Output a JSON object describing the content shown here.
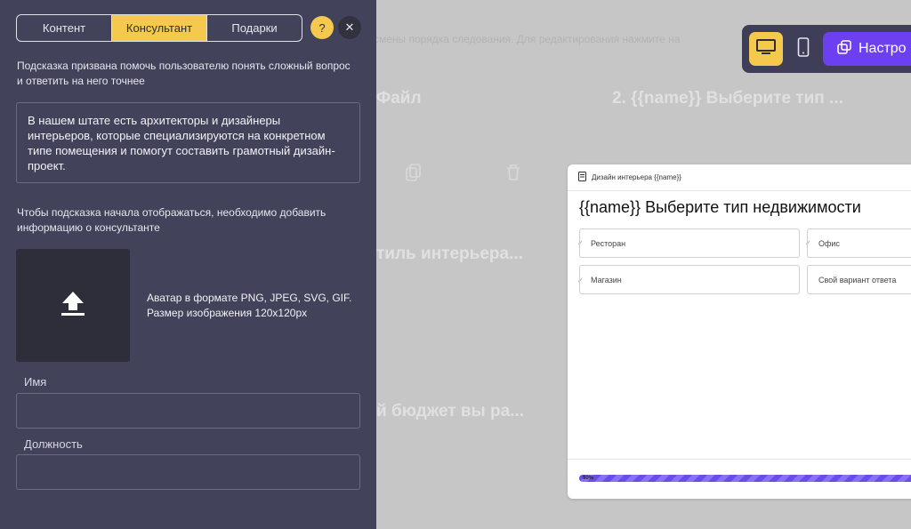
{
  "panel": {
    "tabs": [
      "Контент",
      "Консультант",
      "Подарки"
    ],
    "active_tab": 1,
    "help_label": "?",
    "close_label": "✕",
    "intro": "Подсказка призвана помочь пользователю понять сложный вопрос и ответить на него точнее",
    "hint_text": "В нашем штате есть архитекторы и дизайнеры интерьеров, которые специализируются на конкретном типе помещения и помогут составить грамотный дизайн-проект.",
    "consultant_note": "Чтобы подсказка начала отображаться, необходимо добавить информацию о консультанте",
    "avatar_note_1": "Аватар в формате PNG, JPEG, SVG, GIF.",
    "avatar_note_2": "Размер изображения 120x120px",
    "name_label": "Имя",
    "name_value": "",
    "position_label": "Должность",
    "position_value": ""
  },
  "background": {
    "hint": "смены порядка следования. Для редактирования нажмите на",
    "step_file": "Файл",
    "step_2": "2. {{name}} Выберите тип ...",
    "step_style": "тиль интерьера...",
    "step_budget": "й бюджет вы ра..."
  },
  "toolbar": {
    "settings_label": "Настро"
  },
  "preview": {
    "header_title": "Дизайн интерьера {{name}}",
    "question": "{{name}} Выберите тип недвижимости",
    "options": [
      "Ресторан",
      "Офис",
      "Магазин",
      "Свой вариант ответа"
    ],
    "progress_label": "90%",
    "progress": 0.9
  },
  "colors": {
    "panel_bg": "#42425a",
    "accent": "#f5c94d",
    "brand": "#6c3ff0"
  }
}
